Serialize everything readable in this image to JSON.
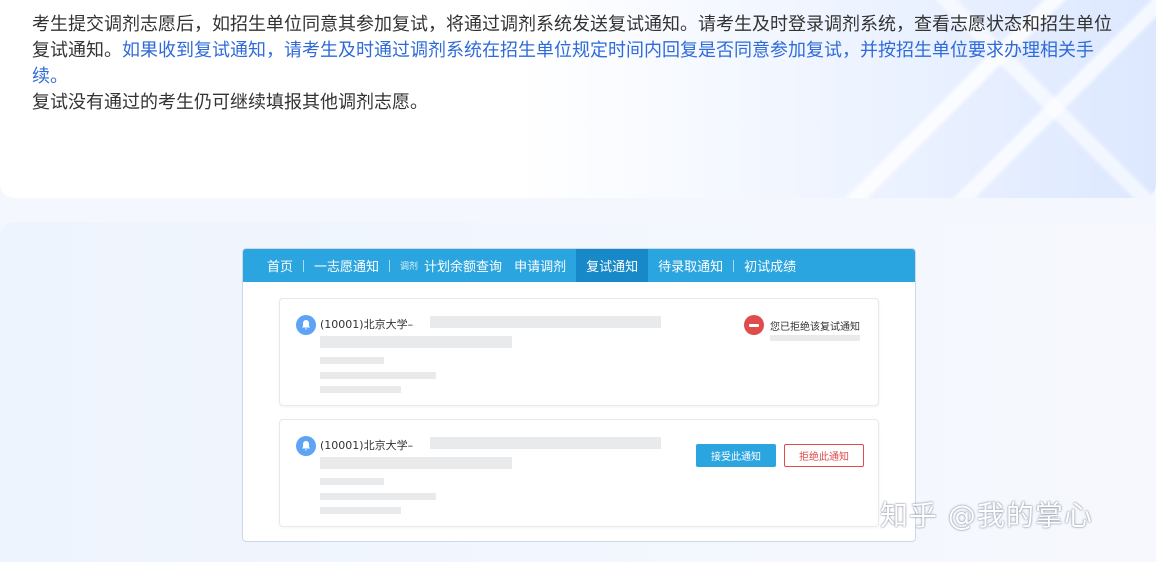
{
  "info": {
    "text_1": "考生提交调剂志愿后，如招生单位同意其参加复试，将通过调剂系统发送复试通知。请考生及时登录调剂系统，查看志愿状态和招生单位复试通知。",
    "text_2_blue": "如果收到复试通知，请考生及时通过调剂系统在招生单位规定时间内回复是否同意参加复试，并按招生单位要求办理相关手续。",
    "text_3": "复试没有通过的考生仍可继续填报其他调剂志愿。"
  },
  "nav": {
    "home": "首页",
    "first_choice": "一志愿通知",
    "adjust_small": "调剂",
    "quota_query": "计划余额查询",
    "apply_adjust": "申请调剂",
    "retest_notice": "复试通知",
    "admission_notice": "待录取通知",
    "first_scores": "初试成绩"
  },
  "notices": [
    {
      "university": "(10001)北京大学–",
      "status_text": "您已拒绝该复试通知"
    },
    {
      "university": "(10001)北京大学–",
      "accept_label": "接受此通知",
      "reject_label": "拒绝此通知"
    }
  ],
  "watermark": "知乎 @我的掌心",
  "colors": {
    "nav_bg": "#2aa5e0",
    "nav_active": "#1788c8",
    "link_blue": "#2f6bd8",
    "reject_red": "#e04b4b"
  }
}
